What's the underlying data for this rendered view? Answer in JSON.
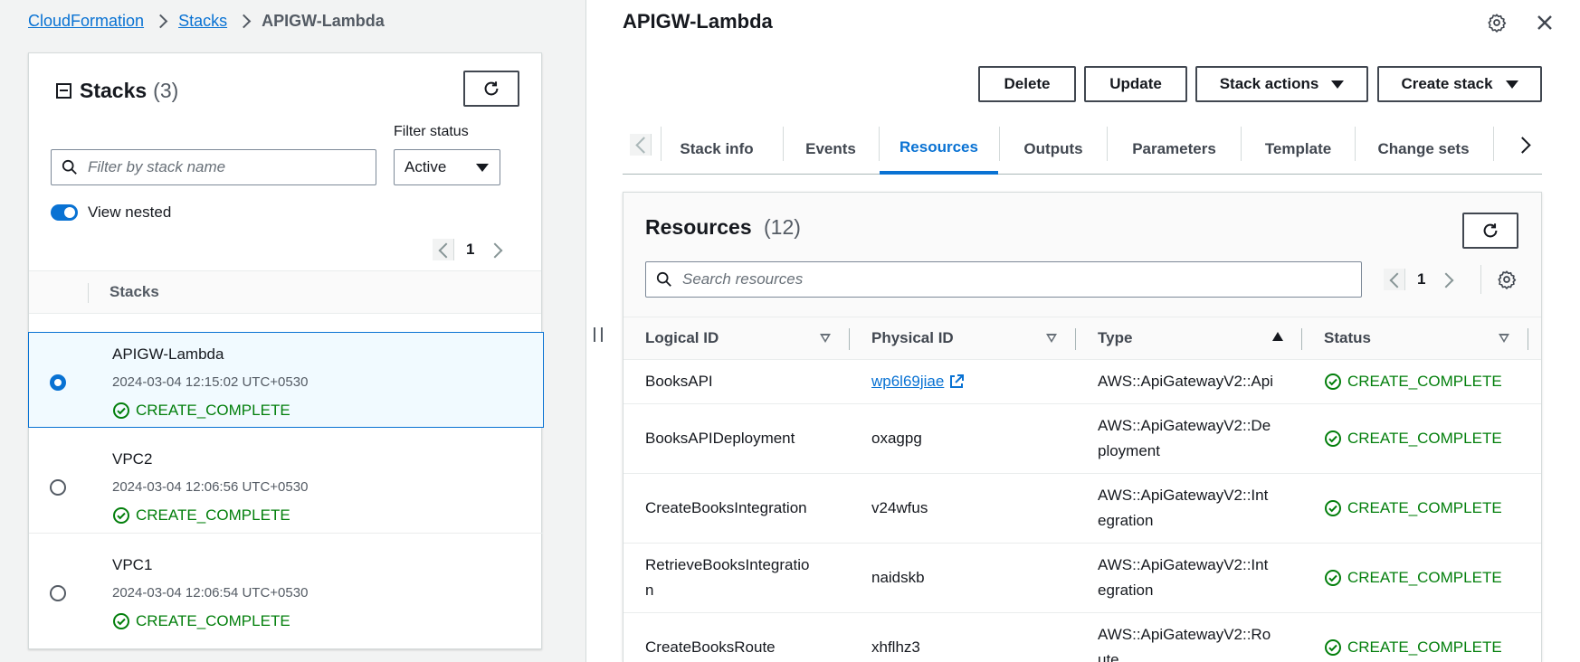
{
  "breadcrumb": {
    "items": [
      {
        "label": "CloudFormation",
        "link": true
      },
      {
        "label": "Stacks",
        "link": true
      },
      {
        "label": "APIGW-Lambda",
        "link": false
      }
    ]
  },
  "stacks_panel": {
    "title": "Stacks",
    "count": "(3)",
    "search_placeholder": "Filter by stack name",
    "filter_label": "Filter status",
    "filter_value": "Active",
    "toggle_label": "View nested",
    "toggle_on": true,
    "page": "1",
    "column_header": "Stacks",
    "rows": [
      {
        "name": "APIGW-Lambda",
        "date": "2024-03-04 12:15:02 UTC+0530",
        "status": "CREATE_COMPLETE",
        "selected": true
      },
      {
        "name": "VPC2",
        "date": "2024-03-04 12:06:56 UTC+0530",
        "status": "CREATE_COMPLETE",
        "selected": false
      },
      {
        "name": "VPC1",
        "date": "2024-03-04 12:06:54 UTC+0530",
        "status": "CREATE_COMPLETE",
        "selected": false
      }
    ]
  },
  "detail": {
    "title": "APIGW-Lambda",
    "buttons": {
      "delete": "Delete",
      "update": "Update",
      "stack_actions": "Stack actions",
      "create_stack": "Create stack"
    },
    "tabs": [
      "Stack info",
      "Events",
      "Resources",
      "Outputs",
      "Parameters",
      "Template",
      "Change sets"
    ],
    "active_tab": "Resources"
  },
  "resources": {
    "title": "Resources",
    "count": "(12)",
    "search_placeholder": "Search resources",
    "page": "1",
    "columns": [
      "Logical ID",
      "Physical ID",
      "Type",
      "Status"
    ],
    "rows": [
      {
        "logical_id": "BooksAPI",
        "physical_id": "wp6l69jiae",
        "physical_link": true,
        "type": "AWS::ApiGatewayV2::Api",
        "status": "CREATE_COMPLETE"
      },
      {
        "logical_id": "BooksAPIDeployment",
        "physical_id": "oxagpg",
        "physical_link": false,
        "type_line1": "AWS::ApiGatewayV2::De",
        "type_line2": "ployment",
        "status": "CREATE_COMPLETE"
      },
      {
        "logical_id": "CreateBooksIntegration",
        "physical_id": "v24wfus",
        "physical_link": false,
        "type_line1": "AWS::ApiGatewayV2::Int",
        "type_line2": "egration",
        "status": "CREATE_COMPLETE"
      },
      {
        "logical_id_line1": "RetrieveBooksIntegratio",
        "logical_id_line2": "n",
        "physical_id": "naidskb",
        "physical_link": false,
        "type_line1": "AWS::ApiGatewayV2::Int",
        "type_line2": "egration",
        "status": "CREATE_COMPLETE"
      },
      {
        "logical_id": "CreateBooksRoute",
        "physical_id": "xhflhz3",
        "physical_link": false,
        "type_line1": "AWS::ApiGatewayV2::Ro",
        "type_line2": "ute",
        "status": "CREATE_COMPLETE"
      }
    ]
  },
  "colors": {
    "link": "#0972d3",
    "success": "#037f0c",
    "text": "#16191f",
    "selected_bg": "#f1faff"
  },
  "icons": [
    "refresh-icon",
    "search-icon",
    "status-success-icon",
    "external-link-icon",
    "settings-icon",
    "close-icon",
    "chevron-left-icon",
    "chevron-right-icon",
    "caret-down-icon"
  ]
}
